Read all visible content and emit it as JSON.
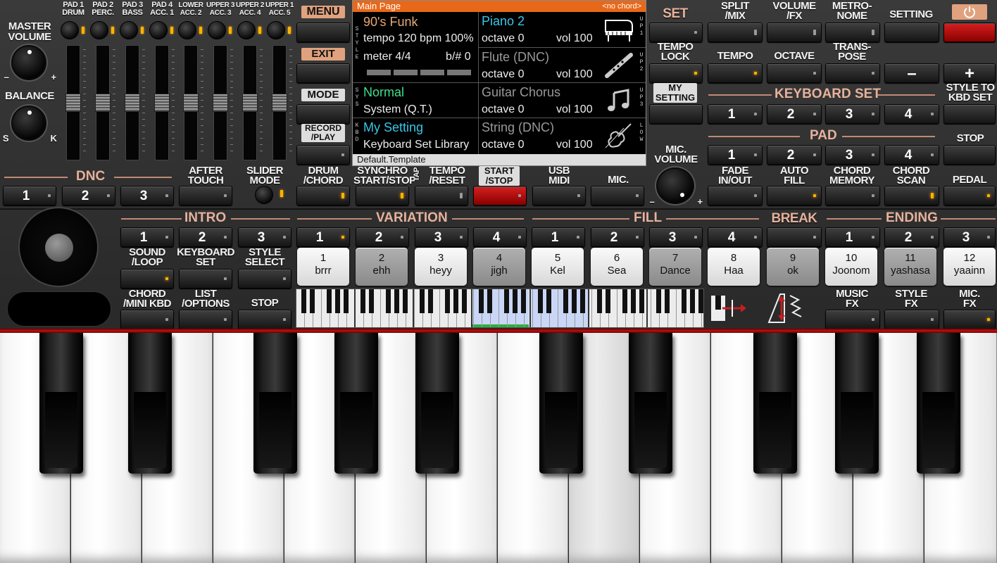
{
  "top_labels": {
    "pad1": "PAD 1\nDRUM",
    "pad2": "PAD 2\nPERC.",
    "pad3": "PAD 3\nBASS",
    "pad4": "PAD 4\nACC. 1",
    "lower": "LOWER\nACC. 2",
    "upper3": "UPPER 3\nACC. 3",
    "upper2": "UPPER 2\nACC. 4",
    "upper1": "UPPER 1\nACC. 5"
  },
  "master_volume": {
    "label": "MASTER\nVOLUME",
    "minus": "–",
    "plus": "+"
  },
  "balance": {
    "label": "BALANCE",
    "s": "S",
    "k": "K"
  },
  "left_menu": {
    "menu": "MENU",
    "exit": "EXIT",
    "mode": "MODE",
    "record": "RECORD\n/PLAY"
  },
  "display": {
    "header": "Main Page",
    "chord": "<no chord>",
    "style_side": "S\nT\nY\nL\nE",
    "sys_side": "S\nY\nS",
    "kbd_side": "K\nB\nD",
    "style_name": "90's Funk",
    "tempo": "tempo 120 bpm 100%",
    "meter": "meter 4/4",
    "bsharp": "b/# 0",
    "sys_name": "Normal",
    "sys_sub": "System (Q.T.)",
    "kbd_name": "My Setting",
    "kbd_sub": "Keyboard Set Library",
    "voices": [
      {
        "name": "Piano 2",
        "octave": "octave 0",
        "vol": "vol 100",
        "part": "U\nP\n1",
        "icon": "piano-icon",
        "active": true
      },
      {
        "name": "Flute (DNC)",
        "octave": "octave 0",
        "vol": "vol 100",
        "part": "U\nP\n2",
        "icon": "flute-icon",
        "active": false
      },
      {
        "name": "Guitar Chorus",
        "octave": "octave 0",
        "vol": "vol 100",
        "part": "U\nP\n3",
        "icon": "music-note-icon",
        "active": false
      },
      {
        "name": "String (DNC)",
        "octave": "octave 0",
        "vol": "vol 100",
        "part": "L\nO\nW",
        "icon": "violin-icon",
        "active": false
      }
    ],
    "footer": "Default.Template"
  },
  "right_top": {
    "set": "SET",
    "split": "SPLIT\n/MIX",
    "volume": "VOLUME\n/FX",
    "metronome": "METRO-\nNOME",
    "setting": "SETTING",
    "power_icon": "power-icon",
    "tempo_lock": "TEMPO\nLOCK",
    "tempo": "TEMPO",
    "octave": "OCTAVE",
    "transpose": "TRANS-\nPOSE",
    "minus": "–",
    "plus": "+",
    "my_setting": "MY\nSETTING",
    "keyboard_set": "KEYBOARD SET",
    "style_to_kbd": "STYLE TO\nKBD SET",
    "kbd_nums": [
      "1",
      "2",
      "3",
      "4"
    ],
    "pad": "PAD",
    "pad_nums": [
      "1",
      "2",
      "3",
      "4"
    ],
    "stop": "STOP"
  },
  "row2": {
    "dnc": "DNC",
    "dnc_nums": [
      "1",
      "2",
      "3"
    ],
    "after_touch": "AFTER\nTOUCH",
    "slider_mode": "SLIDER\nMODE",
    "drum_chord": "DRUM\n/CHORD",
    "synchro": "SYNCHRO\nSTART/STOP",
    "tap": "TAP",
    "tempo_reset": "TEMPO\n/RESET",
    "start_stop": "START\n/STOP",
    "usb_midi": "USB\nMIDI",
    "mic": "MIC.",
    "mic_volume": "MIC.\nVOLUME",
    "fade": "FADE\nIN/OUT",
    "auto_fill": "AUTO\nFILL",
    "chord_memory": "CHORD\nMEMORY",
    "chord_scan": "CHORD\nSCAN",
    "pedal": "PEDAL"
  },
  "sections": {
    "intro": "INTRO",
    "variation": "VARIATION",
    "fill": "FILL",
    "break": "BREAK",
    "ending": "ENDING",
    "intro_nums": [
      "1",
      "2",
      "3"
    ],
    "variation_nums": [
      "1",
      "2",
      "3",
      "4"
    ],
    "fill_nums": [
      "1",
      "2",
      "3",
      "4"
    ],
    "ending_nums": [
      "1",
      "2",
      "3"
    ]
  },
  "left_bottom": {
    "sound_loop": "SOUND\n/LOOP",
    "keyboard_set": "KEYBOARD\nSET",
    "style_select": "STYLE\nSELECT",
    "chord_mini": "CHORD\n/MINI KBD",
    "list_options": "LIST\n/OPTIONS",
    "stop": "STOP"
  },
  "pads": [
    {
      "num": "1",
      "name": "brrr",
      "shade": "light"
    },
    {
      "num": "2",
      "name": "ehh",
      "shade": "dark"
    },
    {
      "num": "3",
      "name": "heyy",
      "shade": "light"
    },
    {
      "num": "4",
      "name": "jigh",
      "shade": "dark"
    },
    {
      "num": "5",
      "name": "Kel",
      "shade": "light"
    },
    {
      "num": "6",
      "name": "Sea",
      "shade": "light"
    },
    {
      "num": "7",
      "name": "Dance",
      "shade": "dark"
    },
    {
      "num": "8",
      "name": "Haa",
      "shade": "light"
    },
    {
      "num": "9",
      "name": "ok",
      "shade": "dark"
    },
    {
      "num": "10",
      "name": "Joonom",
      "shade": "light"
    },
    {
      "num": "11",
      "name": "yashasa",
      "shade": "dark"
    },
    {
      "num": "12",
      "name": "yaainn",
      "shade": "light"
    }
  ],
  "fx": {
    "music": "MUSIC\nFX",
    "style": "STYLE\nFX",
    "mic": "MIC.\nFX"
  },
  "colors": {
    "accent": "#e8681a",
    "section": "#e6b19c",
    "led": "#ffb400",
    "cyan": "#39c6e8",
    "green": "#3ee08a",
    "start": "#cc1a1a"
  }
}
